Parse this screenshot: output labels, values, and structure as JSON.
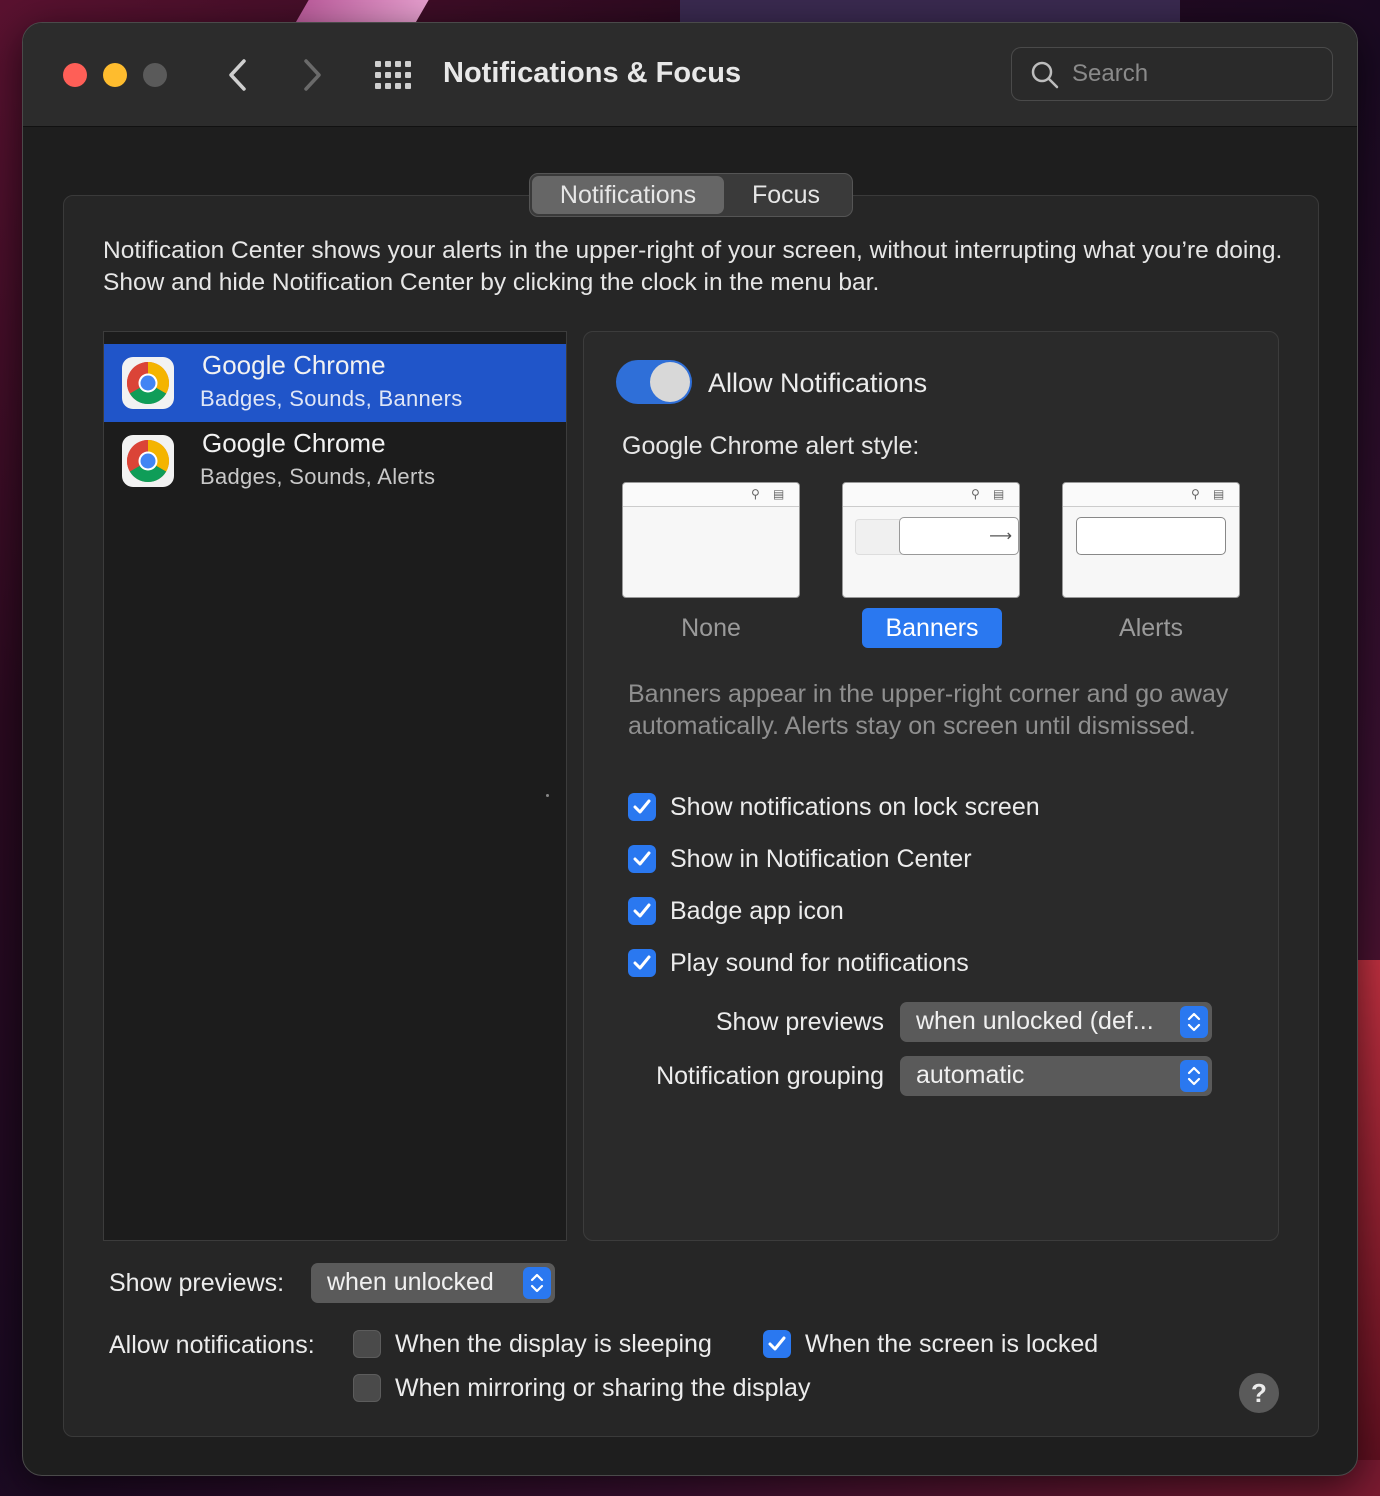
{
  "window": {
    "title": "Notifications & Focus"
  },
  "search": {
    "placeholder": "Search"
  },
  "tabs": [
    {
      "label": "Notifications",
      "active": true
    },
    {
      "label": "Focus",
      "active": false
    }
  ],
  "description": "Notification Center shows your alerts in the upper-right of your screen, without interrupting what you’re doing. Show and hide Notification Center by clicking the clock in the menu bar.",
  "apps": [
    {
      "name": "Google Chrome",
      "detail": "Badges, Sounds, Banners",
      "selected": true
    },
    {
      "name": "Google Chrome",
      "detail": "Badges, Sounds, Alerts",
      "selected": false
    }
  ],
  "panel": {
    "allow_label": "Allow Notifications",
    "allow_on": true,
    "style_label": "Google Chrome alert style:",
    "styles": [
      {
        "label": "None",
        "selected": false
      },
      {
        "label": "Banners",
        "selected": true
      },
      {
        "label": "Alerts",
        "selected": false
      }
    ],
    "hint": "Banners appear in the upper-right corner and go away automatically. Alerts stay on screen until dismissed.",
    "checkboxes": [
      {
        "label": "Show notifications on lock screen",
        "checked": true
      },
      {
        "label": "Show in Notification Center",
        "checked": true
      },
      {
        "label": "Badge app icon",
        "checked": true
      },
      {
        "label": "Play sound for notifications",
        "checked": true
      }
    ],
    "show_previews_label": "Show previews",
    "show_previews_value": "when unlocked (def...",
    "grouping_label": "Notification grouping",
    "grouping_value": "automatic"
  },
  "bottom": {
    "show_previews_label": "Show previews:",
    "show_previews_value": "when unlocked",
    "allow_label": "Allow notifications:",
    "options": [
      {
        "label": "When the display is sleeping",
        "checked": false
      },
      {
        "label": "When the screen is locked",
        "checked": true
      },
      {
        "label": "When mirroring or sharing the display",
        "checked": false
      }
    ],
    "help": "?"
  },
  "colors": {
    "accent": "#2a78f0",
    "selection": "#2055c9",
    "close": "#fe5f57",
    "minimize": "#febc2e"
  }
}
